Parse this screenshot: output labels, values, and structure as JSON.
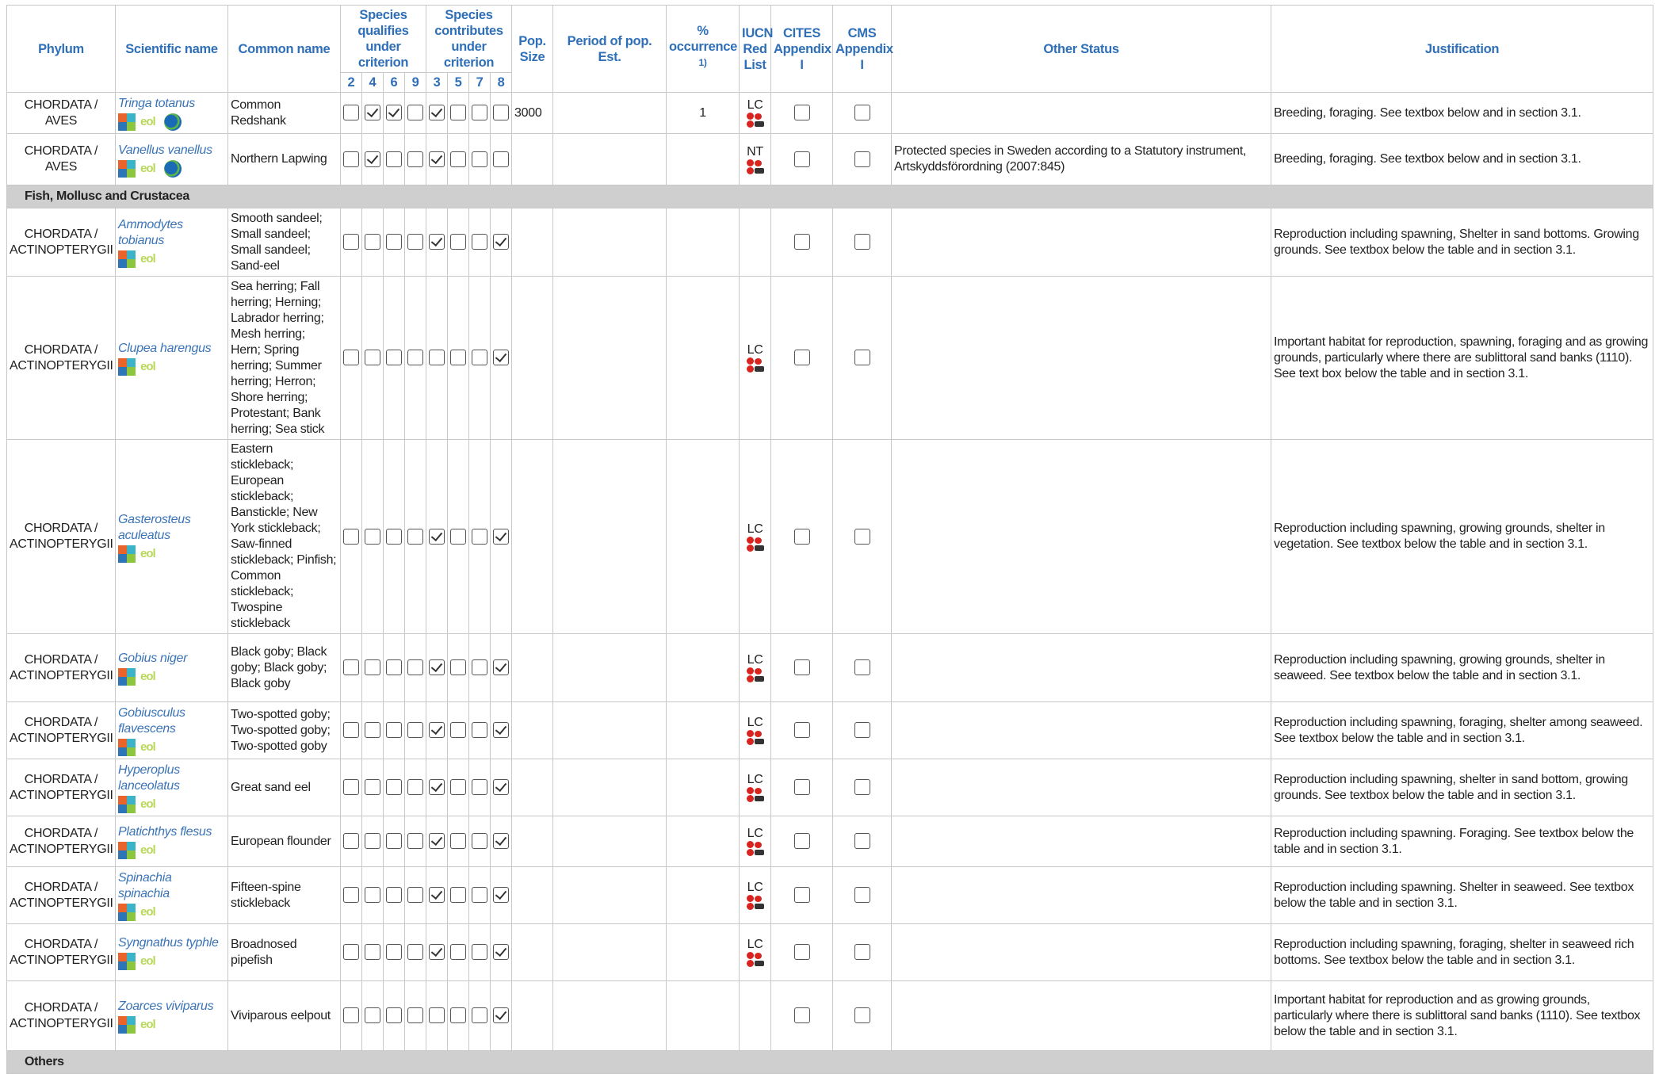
{
  "headers": {
    "phylum": "Phylum",
    "scientific": "Scientific name",
    "common": "Common name",
    "qualifies": "Species qualifies under criterion",
    "contributes": "Species contributes under criterion",
    "qual_criteria": [
      "2",
      "4",
      "6",
      "9"
    ],
    "contrib_criteria": [
      "3",
      "5",
      "7",
      "8"
    ],
    "pop_size": "Pop. Size",
    "period": "Period of pop. Est.",
    "occurrence": "% occurrence",
    "occurrence_note": "1)",
    "iucn": "IUCN Red List",
    "cites": "CITES Appendix I",
    "cms": "CMS Appendix I",
    "other": "Other Status",
    "justification": "Justification"
  },
  "rows": [
    {
      "type": "species",
      "phylum1": "CHORDATA /",
      "phylum2": "AVES",
      "sci": "Tringa totanus",
      "globe": true,
      "common": "Common Redshank",
      "checks": [
        false,
        true,
        true,
        false,
        true,
        false,
        false,
        false
      ],
      "pop": "3000",
      "period": "",
      "occ": "1",
      "iucn": "LC",
      "other": "",
      "just": "Breeding, foraging. See textbox below and in section 3.1.",
      "h": 52
    },
    {
      "type": "species",
      "phylum1": "CHORDATA /",
      "phylum2": "AVES",
      "sci": "Vanellus vanellus",
      "globe": true,
      "common": "Northern Lapwing",
      "checks": [
        false,
        true,
        false,
        false,
        true,
        false,
        false,
        false
      ],
      "pop": "",
      "period": "",
      "occ": "",
      "iucn": "NT",
      "other": "Protected species in Sweden according to a Statutory instrument, Artskyddsförordning (2007:845)",
      "just": "Breeding, foraging. See textbox below and in section 3.1.",
      "h": 65
    },
    {
      "type": "group",
      "label": "Fish, Mollusc and Crustacea"
    },
    {
      "type": "species",
      "phylum1": "CHORDATA /",
      "phylum2": "ACTINOPTERYGII",
      "sci": "Ammodytes tobianus",
      "globe": false,
      "common": "Smooth sandeel; Small sandeel; Small sandeel; Sand-eel",
      "checks": [
        false,
        false,
        false,
        false,
        true,
        false,
        false,
        true
      ],
      "pop": "",
      "period": "",
      "occ": "",
      "iucn": "",
      "other": "",
      "just": "Reproduction including spawning, Shelter in sand bottoms. Growing grounds. See textbox below the table and in section 3.1.",
      "h": 86
    },
    {
      "type": "species",
      "phylum1": "CHORDATA /",
      "phylum2": "ACTINOPTERYGII",
      "sci": "Clupea harengus",
      "globe": false,
      "common": "Sea herring; Fall herring; Herning; Labrador herring; Mesh herring; Hern; Spring herring; Summer herring; Herron; Shore herring; Protestant; Bank herring; Sea stick",
      "checks": [
        false,
        false,
        false,
        false,
        false,
        false,
        false,
        true
      ],
      "pop": "",
      "period": "",
      "occ": "",
      "iucn": "LC",
      "other": "",
      "just": "Important habitat for reproduction, spawning, foraging and as growing grounds, particularly where there are sublittoral sand banks (1110). See text box below the table and in section 3.1.",
      "h": 206
    },
    {
      "type": "species",
      "phylum1": "CHORDATA /",
      "phylum2": "ACTINOPTERYGII",
      "sci": "Gasterosteus aculeatus",
      "globe": false,
      "common": "Eastern stickleback; European stickleback; Banstickle; New York stickleback; Saw-finned stickleback; Pinfish; Common stickleback; Twospine stickleback",
      "checks": [
        false,
        false,
        false,
        false,
        true,
        false,
        false,
        true
      ],
      "pop": "",
      "period": "",
      "occ": "",
      "iucn": "LC",
      "other": "",
      "just": "Reproduction including spawning, growing grounds, shelter in vegetation. See textbox below the table and in section 3.1.",
      "h": 245
    },
    {
      "type": "species",
      "phylum1": "CHORDATA /",
      "phylum2": "ACTINOPTERYGII",
      "sci": "Gobius niger",
      "globe": false,
      "common": "Black goby; Black goby; Black goby; Black goby",
      "checks": [
        false,
        false,
        false,
        false,
        true,
        false,
        false,
        true
      ],
      "pop": "",
      "period": "",
      "occ": "",
      "iucn": "LC",
      "other": "",
      "just": "Reproduction including spawning, growing grounds, shelter in seaweed. See textbox below the table and in section 3.1.",
      "h": 86
    },
    {
      "type": "species",
      "phylum1": "CHORDATA /",
      "phylum2": "ACTINOPTERYGII",
      "sci": "Gobiusculus flavescens",
      "globe": false,
      "common": "Two-spotted goby; Two-spotted goby; Two-spotted goby",
      "checks": [
        false,
        false,
        false,
        false,
        true,
        false,
        false,
        true
      ],
      "pop": "",
      "period": "",
      "occ": "",
      "iucn": "LC",
      "other": "",
      "just": "Reproduction including spawning, foraging, shelter among seaweed. See textbox below the table and in section 3.1.",
      "h": 72
    },
    {
      "type": "species",
      "phylum1": "CHORDATA /",
      "phylum2": "ACTINOPTERYGII",
      "sci": "Hyperoplus lanceolatus",
      "globe": false,
      "common": "Great sand eel",
      "checks": [
        false,
        false,
        false,
        false,
        true,
        false,
        false,
        true
      ],
      "pop": "",
      "period": "",
      "occ": "",
      "iucn": "LC",
      "other": "",
      "just": "Reproduction including spawning, shelter in sand bottom, growing grounds. See textbox below the table and in section 3.1.",
      "h": 72
    },
    {
      "type": "species",
      "phylum1": "CHORDATA /",
      "phylum2": "ACTINOPTERYGII",
      "sci": "Platichthys flesus",
      "globe": false,
      "common": "European flounder",
      "checks": [
        false,
        false,
        false,
        false,
        true,
        false,
        false,
        true
      ],
      "pop": "",
      "period": "",
      "occ": "",
      "iucn": "LC",
      "other": "",
      "just": "Reproduction including spawning. Foraging. See textbox below the table and in section 3.1.",
      "h": 64
    },
    {
      "type": "species",
      "phylum1": "CHORDATA /",
      "phylum2": "ACTINOPTERYGII",
      "sci": "Spinachia spinachia",
      "globe": false,
      "common": "Fifteen-spine stickleback",
      "checks": [
        false,
        false,
        false,
        false,
        true,
        false,
        false,
        true
      ],
      "pop": "",
      "period": "",
      "occ": "",
      "iucn": "LC",
      "other": "",
      "just": "Reproduction including spawning. Shelter in seaweed. See textbox below the table and in section 3.1.",
      "h": 72
    },
    {
      "type": "species",
      "phylum1": "CHORDATA /",
      "phylum2": "ACTINOPTERYGII",
      "sci": "Syngnathus typhle",
      "globe": false,
      "common": "Broadnosed pipefish",
      "checks": [
        false,
        false,
        false,
        false,
        true,
        false,
        false,
        true
      ],
      "pop": "",
      "period": "",
      "occ": "",
      "iucn": "LC",
      "other": "",
      "just": "Reproduction including spawning, foraging, shelter in seaweed rich bottoms. See textbox below the table and in section 3.1.",
      "h": 72
    },
    {
      "type": "species",
      "phylum1": "CHORDATA /",
      "phylum2": "ACTINOPTERYGII",
      "sci": "Zoarces viviparus",
      "globe": false,
      "common": "Viviparous eelpout",
      "checks": [
        false,
        false,
        false,
        false,
        false,
        false,
        false,
        true
      ],
      "pop": "",
      "period": "",
      "occ": "",
      "iucn": "",
      "other": "",
      "just": "Important habitat for reproduction and as growing grounds, particularly where there is sublittoral sand banks (1110). See textbox below the table and in section 3.1.",
      "h": 88
    },
    {
      "type": "group",
      "label": "Others"
    }
  ]
}
